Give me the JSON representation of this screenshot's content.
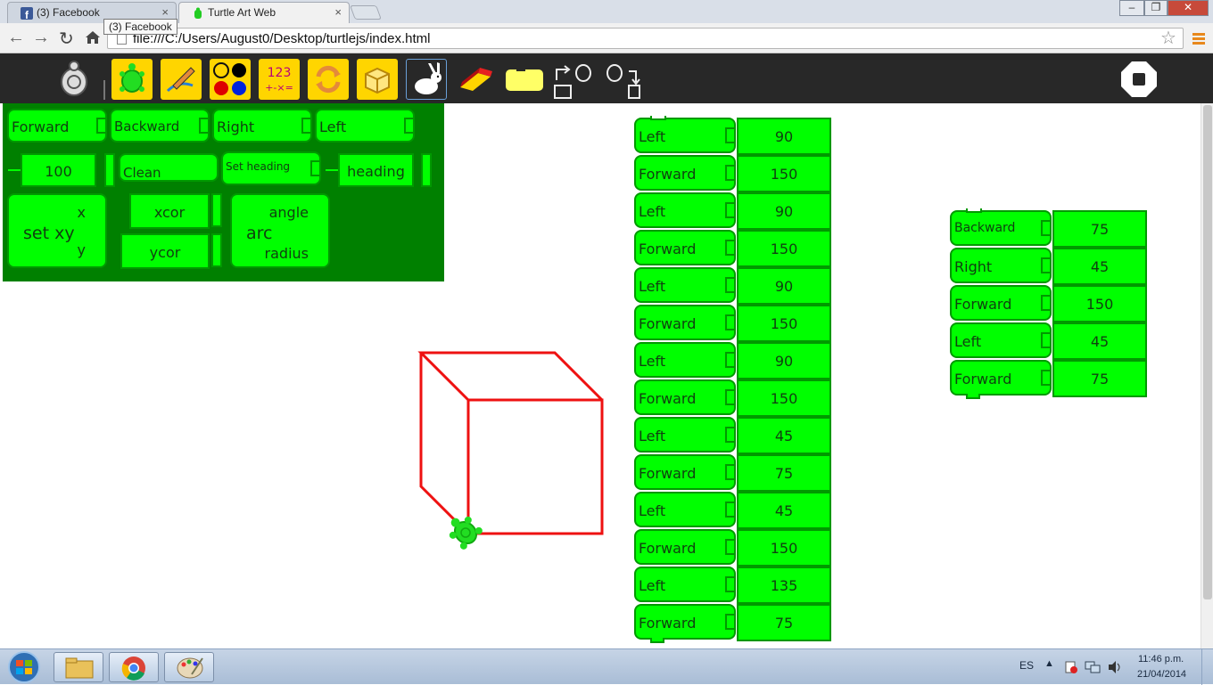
{
  "browser": {
    "tabs": [
      {
        "label": "(3) Facebook",
        "active": false,
        "close": "×"
      },
      {
        "label": "Turtle Art Web",
        "active": true,
        "close": "×"
      }
    ],
    "tooltip": "(3) Facebook",
    "url": "file:///C:/Users/August0/Desktop/turtlejs/index.html",
    "window_buttons": [
      "–",
      "❐",
      "✕"
    ]
  },
  "toolbar": {
    "buttons": [
      "logo",
      "turtle-palette",
      "pen-palette",
      "colors-palette",
      "numbers-palette",
      "flow-palette",
      "blocks-palette",
      "fast-run",
      "erase",
      "block-shape",
      "save",
      "load",
      "stop"
    ],
    "numbers_icon": {
      "top": "123",
      "bottom": "+-×="
    }
  },
  "palette": {
    "row1": [
      "Forward",
      "Backward",
      "Right",
      "Left"
    ],
    "row2": {
      "num": "100",
      "clean": "Clean",
      "set_heading": "Set heading",
      "heading": "heading"
    },
    "setxy": {
      "label": "set xy",
      "x": "x",
      "y": "y",
      "xcor": "xcor",
      "ycor": "ycor"
    },
    "arc": {
      "label": "arc",
      "angle": "angle",
      "radius": "radius"
    }
  },
  "program1": [
    {
      "cmd": "Left",
      "arg": "90"
    },
    {
      "cmd": "Forward",
      "arg": "150"
    },
    {
      "cmd": "Left",
      "arg": "90"
    },
    {
      "cmd": "Forward",
      "arg": "150"
    },
    {
      "cmd": "Left",
      "arg": "90"
    },
    {
      "cmd": "Forward",
      "arg": "150"
    },
    {
      "cmd": "Left",
      "arg": "90"
    },
    {
      "cmd": "Forward",
      "arg": "150"
    },
    {
      "cmd": "Left",
      "arg": "45"
    },
    {
      "cmd": "Forward",
      "arg": "75"
    },
    {
      "cmd": "Left",
      "arg": "45"
    },
    {
      "cmd": "Forward",
      "arg": "150"
    },
    {
      "cmd": "Left",
      "arg": "135"
    },
    {
      "cmd": "Forward",
      "arg": "75"
    }
  ],
  "program2": [
    {
      "cmd": "Backward",
      "arg": "75"
    },
    {
      "cmd": "Right",
      "arg": "45"
    },
    {
      "cmd": "Forward",
      "arg": "150"
    },
    {
      "cmd": "Left",
      "arg": "45"
    },
    {
      "cmd": "Forward",
      "arg": "75"
    }
  ],
  "drawing": {
    "pen_color": "#ee1111"
  },
  "taskbar": {
    "lang": "ES",
    "time": "11:46 p.m.",
    "date": "21/04/2014"
  },
  "colors": {
    "block_fill": "#00ff00",
    "block_border": "#009900",
    "palette_bg": "#008000",
    "toolbar_bg": "#282828",
    "button_yellow": "#ffd500"
  }
}
